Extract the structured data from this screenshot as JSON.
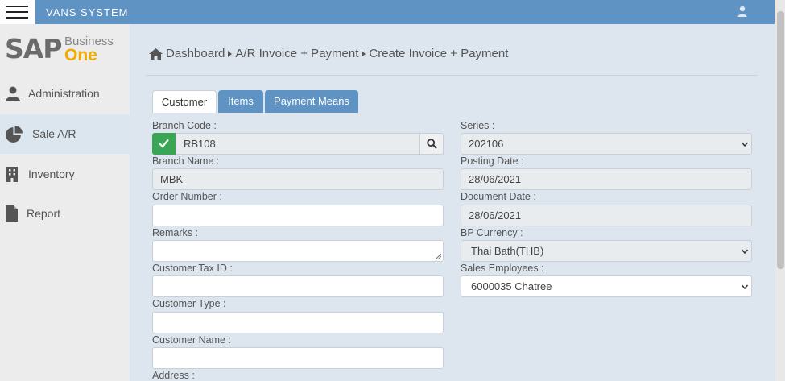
{
  "app": {
    "title": "VANS SYSTEM"
  },
  "icons": {
    "menu": "menu-icon",
    "user": "user-icon",
    "home": "home-icon",
    "admin": "user-icon",
    "sale": "pie-chart-icon",
    "inventory": "building-icon",
    "report": "file-icon",
    "check": "check-icon",
    "search": "search-icon"
  },
  "colors": {
    "topbar": "#5f93c3",
    "tab_inactive": "#5f93c3",
    "check_button": "#3aa655",
    "logo_accent": "#f0ab00"
  },
  "logo": {
    "sap": "SAP",
    "business": "Business",
    "one": "One"
  },
  "sidebar": {
    "items": [
      {
        "label": "Administration",
        "active": false
      },
      {
        "label": "Sale A/R",
        "active": true
      },
      {
        "label": "Inventory",
        "active": false
      },
      {
        "label": "Report",
        "active": false
      }
    ]
  },
  "breadcrumb": {
    "items": [
      "Dashboard",
      "A/R Invoice + Payment",
      "Create Invoice + Payment"
    ]
  },
  "tabs": [
    {
      "label": "Customer",
      "active": true
    },
    {
      "label": "Items",
      "active": false
    },
    {
      "label": "Payment Means",
      "active": false
    }
  ],
  "form": {
    "branch_code": {
      "label": "Branch Code :",
      "value": "RB108"
    },
    "branch_name": {
      "label": "Branch Name :",
      "value": "MBK"
    },
    "order_number": {
      "label": "Order Number :",
      "value": ""
    },
    "remarks": {
      "label": "Remarks :",
      "value": ""
    },
    "customer_tax_id": {
      "label": "Customer Tax ID :",
      "value": ""
    },
    "customer_type": {
      "label": "Customer Type :",
      "value": ""
    },
    "customer_name": {
      "label": "Customer Name :",
      "value": ""
    },
    "address": {
      "label": "Address :"
    },
    "series": {
      "label": "Series :",
      "value": "202106"
    },
    "posting_date": {
      "label": "Posting Date :",
      "value": "28/06/2021"
    },
    "document_date": {
      "label": "Document Date :",
      "value": "28/06/2021"
    },
    "bp_currency": {
      "label": "BP Currency :",
      "value": "Thai Bath(THB)"
    },
    "sales_employees": {
      "label": "Sales Employees :",
      "value": "6000035 Chatree"
    }
  }
}
